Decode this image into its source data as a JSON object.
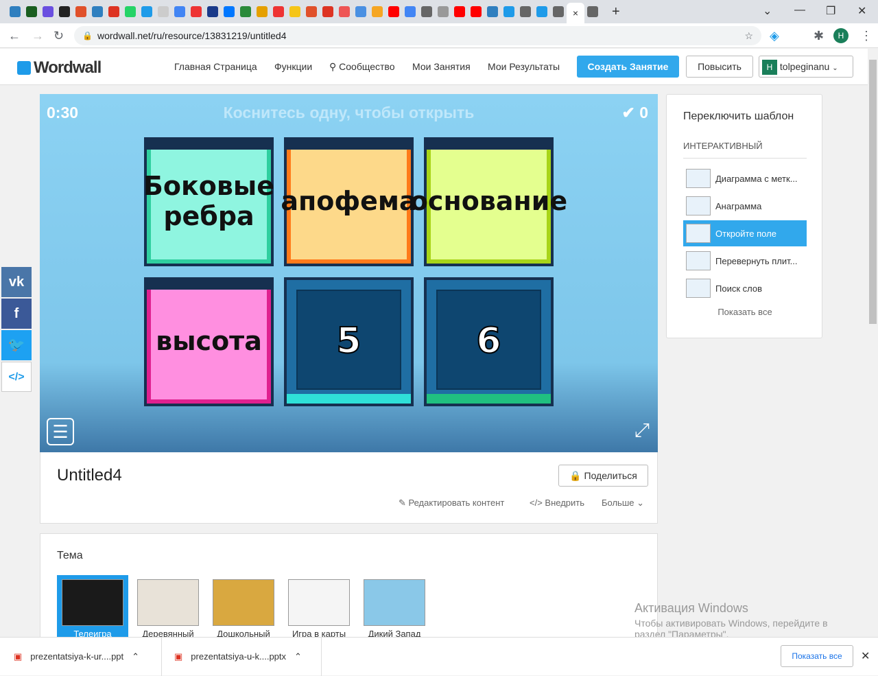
{
  "browser": {
    "favicon_colors": [
      "#2f7fbf",
      "#1a5e20",
      "#6a4fe0",
      "#222",
      "#e0502a",
      "#2f7fbf",
      "#d32",
      "#25d366",
      "#1e9be9",
      "#ccc",
      "#4285f4",
      "#e33",
      "#1a3a8a",
      "#0077ff",
      "#2a8a3a",
      "#e5a000",
      "#e33",
      "#f5c518",
      "#e0502a",
      "#d32",
      "#e55",
      "#4a90e2",
      "#f5a623",
      "#f00",
      "#4285f4",
      "#666",
      "#999",
      "#f00",
      "#f00",
      "#2f7fbf",
      "#1e9be9",
      "#666",
      "#1e9be9",
      "#666",
      "#666"
    ],
    "active_tab_close": "×",
    "new_tab": "+",
    "url": "wordwall.net/ru/resource/13831219/untitled4",
    "profile_initial": "H"
  },
  "header": {
    "logo": "Wordwall",
    "nav": [
      "Главная Страница",
      "Функции",
      "Сообщество",
      "Мои Занятия",
      "Мои Результаты"
    ],
    "create": "Создать Занятие",
    "upgrade": "Повысить",
    "user": "tolpeginanu",
    "user_initial": "H"
  },
  "game": {
    "timer": "0:30",
    "instruction": "Коснитесь одну, чтобы открыть",
    "score": "0",
    "tiles": [
      {
        "text": "Боковые ребра",
        "color": "#8ff5e0",
        "border": "#2fcf9f"
      },
      {
        "text": "апофема",
        "color": "#fdd98a",
        "border": "#ff7a1a"
      },
      {
        "text": "основание",
        "color": "#e4ff8f",
        "border": "#a8d418"
      },
      {
        "text": "высота",
        "color": "#ff8fe0",
        "border": "#e0208f"
      },
      {
        "text": "5",
        "color": "",
        "border": "#2fe0d8"
      },
      {
        "text": "6",
        "color": "",
        "border": "#20c080"
      }
    ]
  },
  "sidebar": {
    "title": "Переключить шаблон",
    "category": "ИНТЕРАКТИВНЫЙ",
    "templates": [
      "Диаграмма с метк...",
      "Анаграмма",
      "Откройте поле",
      "Перевернуть плит...",
      "Поиск слов"
    ],
    "selected": 2,
    "show_all": "Показать все"
  },
  "activity": {
    "title": "Untitled4",
    "share": "Поделиться",
    "edit": "Редактировать контент",
    "embed": "Внедрить",
    "more": "Больше"
  },
  "theme": {
    "heading": "Тема",
    "items": [
      "Телеигра",
      "Деревянный",
      "Дошкольный",
      "Игра в карты",
      "Дикий Запад"
    ]
  },
  "downloads": {
    "items": [
      "prezentatsiya-k-ur....ppt",
      "prezentatsiya-u-k....pptx"
    ],
    "show_all": "Показать все"
  },
  "watermark": {
    "title": "Активация Windows",
    "text": "Чтобы активировать Windows, перейдите в раздел \"Параметры\"."
  }
}
